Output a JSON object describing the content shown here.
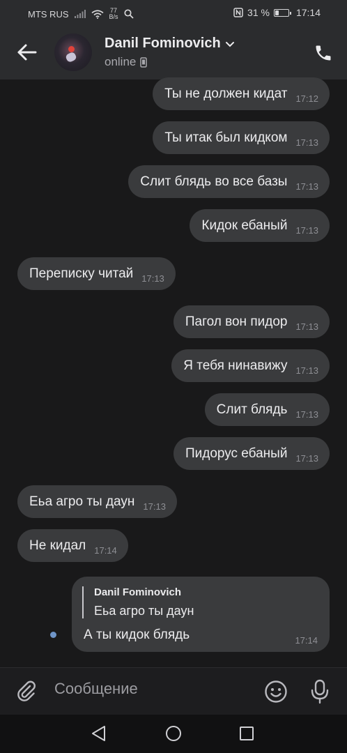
{
  "status_bar": {
    "carrier": "MTS RUS",
    "net_speed_value": "77",
    "net_speed_unit": "B/s",
    "battery": "31 %",
    "battery_level": 0.31,
    "time": "17:14",
    "icons": [
      "signal-icon",
      "wifi-icon",
      "search-icon",
      "nfc-icon",
      "battery-icon"
    ]
  },
  "header": {
    "contact_name": "Danil Fominovich",
    "status": "online",
    "icons": [
      "back-arrow-icon",
      "avatar",
      "chevron-down-icon",
      "mobile-device-icon",
      "phone-icon"
    ]
  },
  "messages": [
    {
      "side": "out",
      "text": "Ты не должен кидат",
      "time": "17:12"
    },
    {
      "side": "out",
      "text": "Ты итак был кидком",
      "time": "17:13"
    },
    {
      "side": "out",
      "text": "Слит блядь во все базы",
      "time": "17:13"
    },
    {
      "side": "out",
      "text": "Кидок ебаный",
      "time": "17:13"
    },
    {
      "side": "in",
      "text": "Переписку читай",
      "time": "17:13"
    },
    {
      "side": "out",
      "text": "Пагол вон пидор",
      "time": "17:13"
    },
    {
      "side": "out",
      "text": "Я тебя нинавижу",
      "time": "17:13"
    },
    {
      "side": "out",
      "text": "Слит блядь",
      "time": "17:13"
    },
    {
      "side": "out",
      "text": "Пидорус ебаный",
      "time": "17:13"
    },
    {
      "side": "in",
      "text": "Еьа агро ты даун",
      "time": "17:13"
    },
    {
      "side": "in",
      "text": "Не кидал",
      "time": "17:14"
    }
  ],
  "reply_message": {
    "quoted_author": "Danil Fominovich",
    "quoted_text": "Еьа агро ты даун",
    "text": "А ты кидок блядь",
    "time": "17:14",
    "unread": true
  },
  "composer": {
    "placeholder": "Сообщение",
    "icons": [
      "attach-icon",
      "emoji-icon",
      "microphone-icon"
    ]
  },
  "nav_bar": {
    "icons": [
      "nav-back-icon",
      "nav-home-icon",
      "nav-recents-icon"
    ]
  },
  "colors": {
    "background": "#19191a",
    "bar": "#2b2c2e",
    "bubble": "#3a3b3d",
    "unread_dot": "#6f95c8"
  }
}
